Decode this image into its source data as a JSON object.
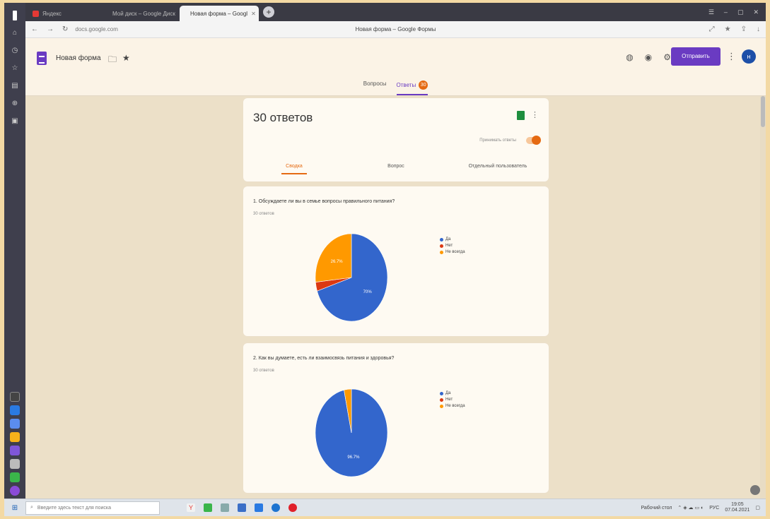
{
  "browser": {
    "tabs": [
      {
        "label": "Яндекс",
        "color": "#e53935"
      },
      {
        "label": "Мой диск – Google Диск",
        "color": "#f4b400"
      },
      {
        "label": "Новая форма – Googl",
        "color": "#6a3bc2"
      }
    ],
    "new_tab": "+",
    "url": "docs.google.com",
    "page_title": "Новая форма – Google Формы"
  },
  "forms": {
    "form_name": "Новая форма",
    "send_label": "Отправить",
    "avatar_letter": "н",
    "tab_questions": "Вопросы",
    "tab_answers": "Ответы",
    "answers_badge": "30"
  },
  "summary": {
    "count": "30 ответов",
    "accepting_label": "Принимать ответы",
    "subtabs": [
      "Сводка",
      "Вопрос",
      "Отдельный пользователь"
    ]
  },
  "questions": [
    {
      "title": "1. Обсуждаете ли вы в семье вопросы правильного питания?",
      "subtitle": "30 ответов",
      "legend": [
        "Да",
        "Нет",
        "Не всегда"
      ]
    },
    {
      "title": "2. Как вы думаете, есть ли взаимосвязь питания и здоровья?",
      "subtitle": "30 ответов",
      "legend": [
        "Да",
        "Нет",
        "Не всегда"
      ]
    }
  ],
  "chart_data": [
    {
      "type": "pie",
      "categories": [
        "Да",
        "Нет",
        "Не всегда"
      ],
      "values": [
        70,
        3.3,
        26.7
      ],
      "labels": [
        "70%",
        "",
        "26.7%"
      ],
      "colors": [
        "#3366cc",
        "#dc3912",
        "#ff9900"
      ]
    },
    {
      "type": "pie",
      "categories": [
        "Да",
        "Нет",
        "Не всегда"
      ],
      "values": [
        96.7,
        0,
        3.3
      ],
      "labels": [
        "96.7%",
        "",
        ""
      ],
      "colors": [
        "#3366cc",
        "#dc3912",
        "#ff9900"
      ]
    }
  ],
  "taskbar": {
    "search_placeholder": "Введите здесь текст для поиска",
    "tray_label": "Рабочий стол",
    "lang": "РУС",
    "time": "19:05",
    "date": "07.04.2021"
  }
}
